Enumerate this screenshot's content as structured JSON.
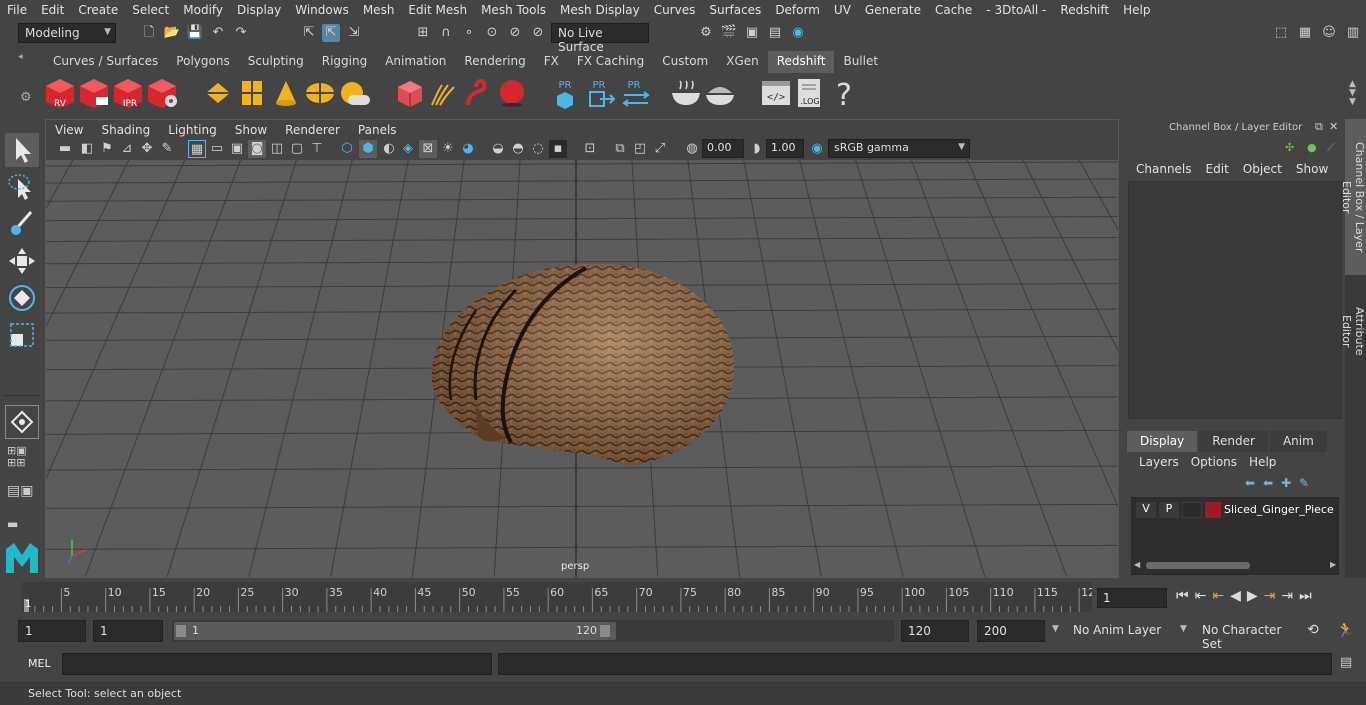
{
  "menubar": [
    "File",
    "Edit",
    "Create",
    "Select",
    "Modify",
    "Display",
    "Windows",
    "Mesh",
    "Edit Mesh",
    "Mesh Tools",
    "Mesh Display",
    "Curves",
    "Surfaces",
    "Deform",
    "UV",
    "Generate",
    "Cache",
    "- 3DtoAll -",
    "Redshift",
    "Help"
  ],
  "status": {
    "mode": "Modeling",
    "live_surface": "No Live Surface"
  },
  "shelf_tabs": [
    "Curves / Surfaces",
    "Polygons",
    "Sculpting",
    "Rigging",
    "Animation",
    "Rendering",
    "FX",
    "FX Caching",
    "Custom",
    "XGen",
    "Redshift",
    "Bullet"
  ],
  "shelf_active": "Redshift",
  "shelf_icons": {
    "rv": "RV",
    "ipr": "IPR",
    "pr": "PR",
    "log": ".LOG",
    "help": "?"
  },
  "viewport": {
    "menu": [
      "View",
      "Shading",
      "Lighting",
      "Show",
      "Renderer",
      "Panels"
    ],
    "exposure": "0.00",
    "gamma": "1.00",
    "color_space": "sRGB gamma",
    "camera_label": "persp"
  },
  "channel_box": {
    "title": "Channel Box / Layer Editor",
    "menu": [
      "Channels",
      "Edit",
      "Object",
      "Show"
    ]
  },
  "layer_editor": {
    "tabs": [
      "Display",
      "Render",
      "Anim"
    ],
    "active_tab": "Display",
    "menu": [
      "Layers",
      "Options",
      "Help"
    ],
    "layer": {
      "v": "V",
      "p": "P",
      "name": "Sliced_Ginger_Piece",
      "color": "#a0182c"
    }
  },
  "side_tabs": [
    "Channel Box / Layer Editor",
    "Attribute Editor"
  ],
  "timeline": {
    "ticks": [
      "5",
      "10",
      "15",
      "20",
      "25",
      "30",
      "35",
      "40",
      "45",
      "50",
      "55",
      "60",
      "65",
      "70",
      "75",
      "80",
      "85",
      "90",
      "95",
      "100",
      "105",
      "110",
      "115",
      "12"
    ],
    "start_marker": "1",
    "current_frame": "1"
  },
  "range": {
    "start": "1",
    "playback_start": "1",
    "slider_start": "1",
    "slider_end": "120",
    "playback_end": "120",
    "end": "200",
    "anim_layer": "No Anim Layer",
    "char_set": "No Character Set"
  },
  "mel": {
    "label": "MEL"
  },
  "help_line": "Select Tool: select an object"
}
